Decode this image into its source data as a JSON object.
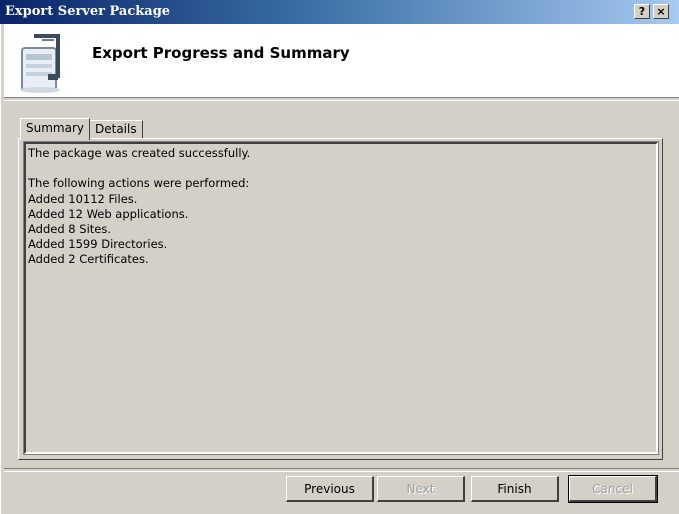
{
  "window": {
    "title": "Export Server Package",
    "help_label": "?",
    "close_label": "×"
  },
  "header": {
    "icon": "server-package-clamp-icon",
    "title": "Export Progress and Summary"
  },
  "tabs": [
    {
      "label": "Summary",
      "active": true
    },
    {
      "label": "Details",
      "active": false
    }
  ],
  "summary": {
    "lines": [
      "The package was created successfully.",
      "",
      "The following actions were performed:",
      "Added 10112 Files.",
      "Added 12 Web applications.",
      "Added 8 Sites.",
      "Added 1599 Directories.",
      "Added 2 Certificates."
    ]
  },
  "buttons": {
    "previous": "Previous",
    "next": "Next",
    "finish": "Finish",
    "cancel": "Cancel"
  }
}
